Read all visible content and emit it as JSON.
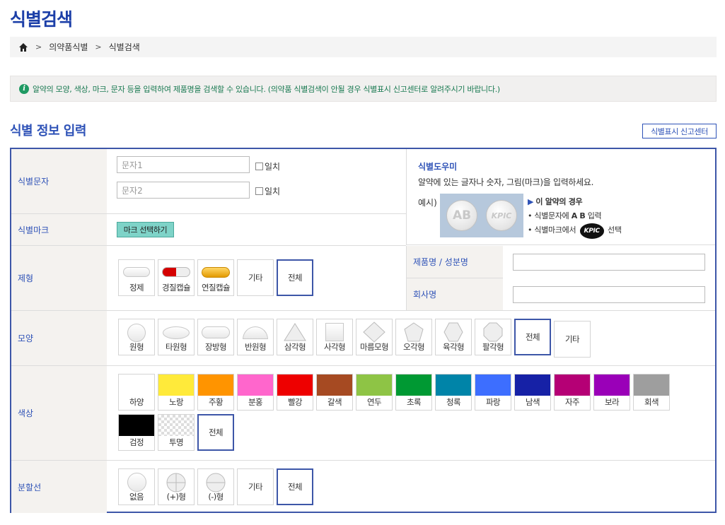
{
  "page_title": "식별검색",
  "breadcrumb": {
    "items": [
      "의약품식별",
      "식별검색"
    ]
  },
  "notice": "알약의 모양, 색상, 마크, 문자 등을 입력하여 제품명을 검색할 수 있습니다. (의약품 식별검색이 안될 경우 식별표시 신고센터로 알려주시기 바랍니다.)",
  "section_title": "식별 정보 입력",
  "report_button": "식별표시 신고센터",
  "ident_text": {
    "label": "식별문자",
    "input1_placeholder": "문자1",
    "input2_placeholder": "문자2",
    "match_label": "일치"
  },
  "ident_mark": {
    "label": "식별마크",
    "button": "마크 선택하기"
  },
  "help": {
    "title": "식별도우미",
    "desc": "알약에 있는 글자나 숫자, 그림(마크)을 입력하세요.",
    "example": "예시)",
    "pill_text1": "AB",
    "pill_text2": "KPIC",
    "case_title": "이 알약의 경우",
    "case_line1_pre": "• 식별문자에 ",
    "case_line1_bold": "A B",
    "case_line1_post": " 입력",
    "case_line2_pre": "• 식별마크에서 ",
    "case_line2_mark": "KPIC",
    "case_line2_post": " 선택"
  },
  "formulation": {
    "label": "제형",
    "options": [
      "정제",
      "경질캡슐",
      "연질캡슐",
      "기타",
      "전체"
    ]
  },
  "product_name": {
    "label": "제품명 / 성분명"
  },
  "company": {
    "label": "회사명"
  },
  "shape": {
    "label": "모양",
    "options": [
      "원형",
      "타원형",
      "장방형",
      "반원형",
      "삼각형",
      "사각형",
      "마름모형",
      "오각형",
      "육각형",
      "팔각형",
      "전체",
      "기타"
    ]
  },
  "color": {
    "label": "색상",
    "options": [
      {
        "name": "하양",
        "hex": "#ffffff"
      },
      {
        "name": "노랑",
        "hex": "#ffea3a"
      },
      {
        "name": "주황",
        "hex": "#ff9400"
      },
      {
        "name": "분홍",
        "hex": "#ff66cc"
      },
      {
        "name": "빨강",
        "hex": "#ee0000"
      },
      {
        "name": "갈색",
        "hex": "#a64a22"
      },
      {
        "name": "연두",
        "hex": "#8ec445"
      },
      {
        "name": "초록",
        "hex": "#009933"
      },
      {
        "name": "청록",
        "hex": "#0084a8"
      },
      {
        "name": "파랑",
        "hex": "#3d6eff"
      },
      {
        "name": "남색",
        "hex": "#1621a6"
      },
      {
        "name": "자주",
        "hex": "#b50075"
      },
      {
        "name": "보라",
        "hex": "#9a00b8"
      },
      {
        "name": "회색",
        "hex": "#9e9e9e"
      },
      {
        "name": "검정",
        "hex": "#000000"
      },
      {
        "name": "투명",
        "hex": "transparent"
      }
    ],
    "all": "전체"
  },
  "score_line": {
    "label": "분할선",
    "options": [
      "없음",
      "(+)형",
      "(-)형",
      "기타",
      "전체"
    ]
  }
}
